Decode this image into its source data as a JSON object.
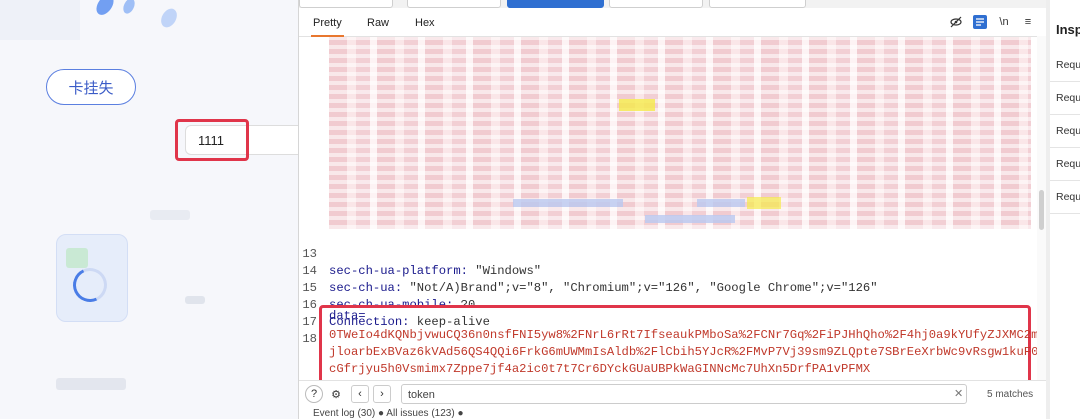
{
  "left_panel": {
    "button_label": "卡挂失",
    "input_value": "1111"
  },
  "burp": {
    "view_tabs": [
      "Pretty",
      "Raw",
      "Hex"
    ],
    "toolbar_icons": [
      "eye-off-icon",
      "wrap-icon",
      "newline-icon",
      "menu-icon"
    ],
    "newline_label": "\\n",
    "lines": [
      {
        "num": "13",
        "key": "sec-ch-ua-platform:",
        "value": " \"Windows\""
      },
      {
        "num": "14",
        "key": "sec-ch-ua:",
        "value": " \"Not/A)Brand\";v=\"8\", \"Chromium\";v=\"126\", \"Google Chrome\";v=\"126\""
      },
      {
        "num": "15",
        "key": "sec-ch-ua-mobile:",
        "value": " ?0"
      },
      {
        "num": "16",
        "key": "Connection:",
        "value": " keep-alive"
      },
      {
        "num": "17",
        "key": "",
        "value": ""
      },
      {
        "num": "18",
        "key": "data=",
        "value": ""
      }
    ],
    "data_value_lines": [
      "0TWeIo4dKQNbjvwuCQ36n0nsfFNI5yw8%2FNrL6rRt7IfseaukPMboSa%2FCNr7Gq%2FiPJHhQho%2F4hj0a9kYUfyZJXMC2m",
      "jloarbExBVaz6kVAd56QS4QQi6FrkG6mUWMmIsAldb%2FlCbih5YJcR%2FMvP7Vj39sm9ZLQpte7SBrEeXrbWc9vRsgw1kuF0",
      "cGfrjyu5h0Vsmimx7Zppe7jf4a2ic0t7t7Cr6DYckGUaUBPkWaGINNcMc7UhXn5DrfPA1vPFMX"
    ],
    "search": {
      "value": "token",
      "matches": "5 matches"
    },
    "bottom_text": "Event log (30) ● All issues (123) ●"
  },
  "inspector": {
    "title": "Insp",
    "rows": [
      "Requ",
      "Requ",
      "Requ",
      "Requ",
      "Requ"
    ]
  }
}
